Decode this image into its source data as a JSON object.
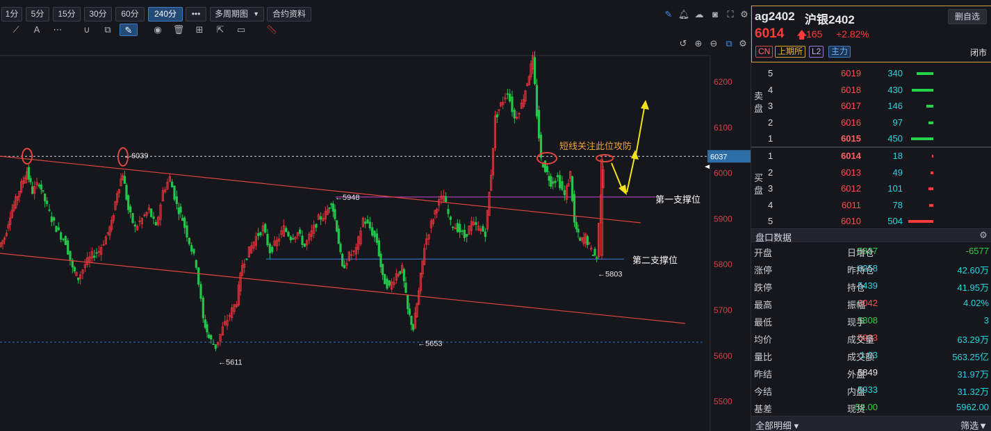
{
  "toolbar": {
    "timeframes": [
      "1分",
      "5分",
      "15分",
      "30分",
      "60分",
      "240分"
    ],
    "active_timeframe": "240分",
    "more_label": "•••",
    "multi_period_label": "多周期图",
    "contract_info_label": "合约资料"
  },
  "chart_data": {
    "type": "candlestick",
    "y_ticks": [
      6200,
      6100,
      6000,
      5900,
      5800,
      5700,
      5600,
      5500
    ],
    "ylim": [
      5450,
      6250
    ],
    "current_price_label": "6037",
    "price_annotations": [
      {
        "text": "6039",
        "value": 6039
      },
      {
        "text": "5948",
        "value": 5948
      },
      {
        "text": "5803",
        "value": 5803
      },
      {
        "text": "5653",
        "value": 5653
      },
      {
        "text": "5611",
        "value": 5611
      }
    ],
    "text_annotations": [
      {
        "text": "短线关注此位攻防"
      },
      {
        "text": "第一支撑位"
      },
      {
        "text": "第二支撑位"
      }
    ],
    "reference_levels": [
      {
        "value": 6037,
        "style": "dashed",
        "color": "#cfd3da"
      },
      {
        "value": 5948,
        "style": "solid",
        "color": "#d048d8"
      },
      {
        "value": 5812,
        "style": "solid",
        "color": "#3f82e0"
      },
      {
        "value": 5630,
        "style": "dashed",
        "color": "#2f6fd0"
      }
    ],
    "colors": {
      "up": "#e8323a",
      "down": "#22c44a",
      "trendline": "#e0453f",
      "arrow": "#f2e21c",
      "marker": "#e0453f"
    }
  },
  "quote": {
    "code": "ag2402",
    "name": "沪银2402",
    "delete_label": "删自选",
    "last_price": "6014",
    "change": "165",
    "change_pct": "+2.82%",
    "tags": [
      "CN",
      "上期所",
      "L2",
      "主力"
    ],
    "status": "闭市"
  },
  "order_book": {
    "ask_label": "卖盘",
    "bid_label": "买盘",
    "asks": [
      {
        "level": "5",
        "price": "6019",
        "vol": "340",
        "bar": 0.68
      },
      {
        "level": "4",
        "price": "6018",
        "vol": "430",
        "bar": 0.86
      },
      {
        "level": "3",
        "price": "6017",
        "vol": "146",
        "bar": 0.29
      },
      {
        "level": "2",
        "price": "6016",
        "vol": "97",
        "bar": 0.19
      },
      {
        "level": "1",
        "price": "6015",
        "vol": "450",
        "bar": 0.9
      }
    ],
    "bids": [
      {
        "level": "1",
        "price": "6014",
        "vol": "18",
        "bar": 0.04
      },
      {
        "level": "2",
        "price": "6013",
        "vol": "49",
        "bar": 0.1
      },
      {
        "level": "3",
        "price": "6012",
        "vol": "101",
        "bar": 0.2
      },
      {
        "level": "4",
        "price": "6011",
        "vol": "78",
        "bar": 0.16
      },
      {
        "level": "5",
        "price": "6010",
        "vol": "504",
        "bar": 1.0
      }
    ]
  },
  "stats": {
    "title": "盘口数据",
    "rows": [
      {
        "l1": "开盘",
        "v1": "5837",
        "c1": "c-green",
        "l2": "日增仓",
        "v2": "-6577",
        "c2": "c-green"
      },
      {
        "l1": "涨停",
        "v1": "6258",
        "c1": "c-cyan",
        "l2": "昨持仓",
        "v2": "42.60万",
        "c2": "c-cyan"
      },
      {
        "l1": "跌停",
        "v1": "5439",
        "c1": "c-cyan",
        "l2": "持仓",
        "v2": "41.95万",
        "c2": "c-cyan"
      },
      {
        "l1": "最高",
        "v1": "6042",
        "c1": "c-red",
        "l2": "振幅",
        "v2": "4.02%",
        "c2": "c-cyan"
      },
      {
        "l1": "最低",
        "v1": "5808",
        "c1": "c-green",
        "l2": "现手",
        "v2": "3",
        "c2": "c-cyan"
      },
      {
        "l1": "均价",
        "v1": "5933",
        "c1": "c-red",
        "l2": "成交量",
        "v2": "63.29万",
        "c2": "c-cyan"
      },
      {
        "l1": "量比",
        "v1": "1.03",
        "c1": "c-cyan",
        "l2": "成交额",
        "v2": "563.25亿",
        "c2": "c-cyan"
      },
      {
        "l1": "昨结",
        "v1": "5849",
        "c1": "c-white",
        "l2": "外盘",
        "v2": "31.97万",
        "c2": "c-cyan"
      },
      {
        "l1": "今结",
        "v1": "5933",
        "c1": "c-cyan",
        "l2": "内盘",
        "v2": "31.32万",
        "c2": "c-cyan"
      },
      {
        "l1": "基差",
        "v1": "-52.00",
        "c1": "c-green",
        "l2": "现货",
        "v2": "5962.00",
        "c2": "c-cyan"
      }
    ]
  },
  "bottom": {
    "detail_label": "全部明细 ▾",
    "filter_label": "筛选"
  }
}
